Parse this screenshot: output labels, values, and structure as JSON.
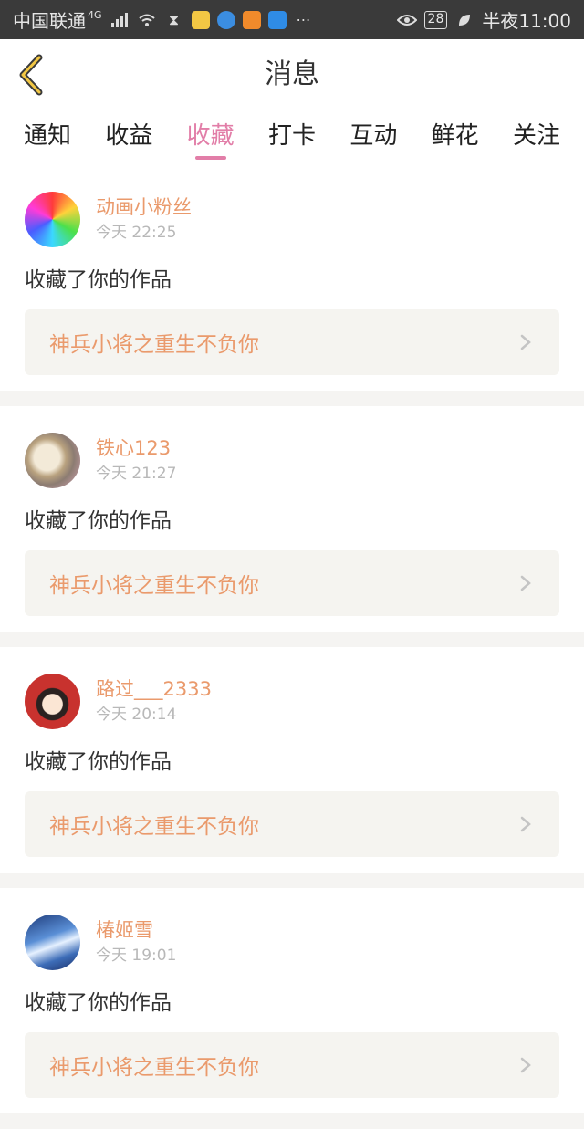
{
  "status": {
    "carrier": "中国联通",
    "network": "4G",
    "battery": "28",
    "time": "半夜11:00"
  },
  "header": {
    "title": "消息"
  },
  "tabs": [
    "通知",
    "收益",
    "收藏",
    "打卡",
    "互动",
    "鲜花",
    "关注"
  ],
  "active_tab": "收藏",
  "items": [
    {
      "user": "动画小粉丝",
      "time": "今天 22:25",
      "action": "收藏了你的作品",
      "work": "神兵小将之重生不负你",
      "avatar_style": "rainbow"
    },
    {
      "user": "铁心123",
      "time": "今天 21:27",
      "action": "收藏了你的作品",
      "work": "神兵小将之重生不负你",
      "avatar_style": "rabbit"
    },
    {
      "user": "路过___2333",
      "time": "今天 20:14",
      "action": "收藏了你的作品",
      "work": "神兵小将之重生不负你",
      "avatar_style": "cartoon"
    },
    {
      "user": "椿姬雪",
      "time": "今天 19:01",
      "action": "收藏了你的作品",
      "work": "神兵小将之重生不负你",
      "avatar_style": "wave"
    }
  ],
  "colors": {
    "accent": "#e27ea8",
    "username": "#ea9a6c",
    "status_bar": "#3a3a3a"
  }
}
